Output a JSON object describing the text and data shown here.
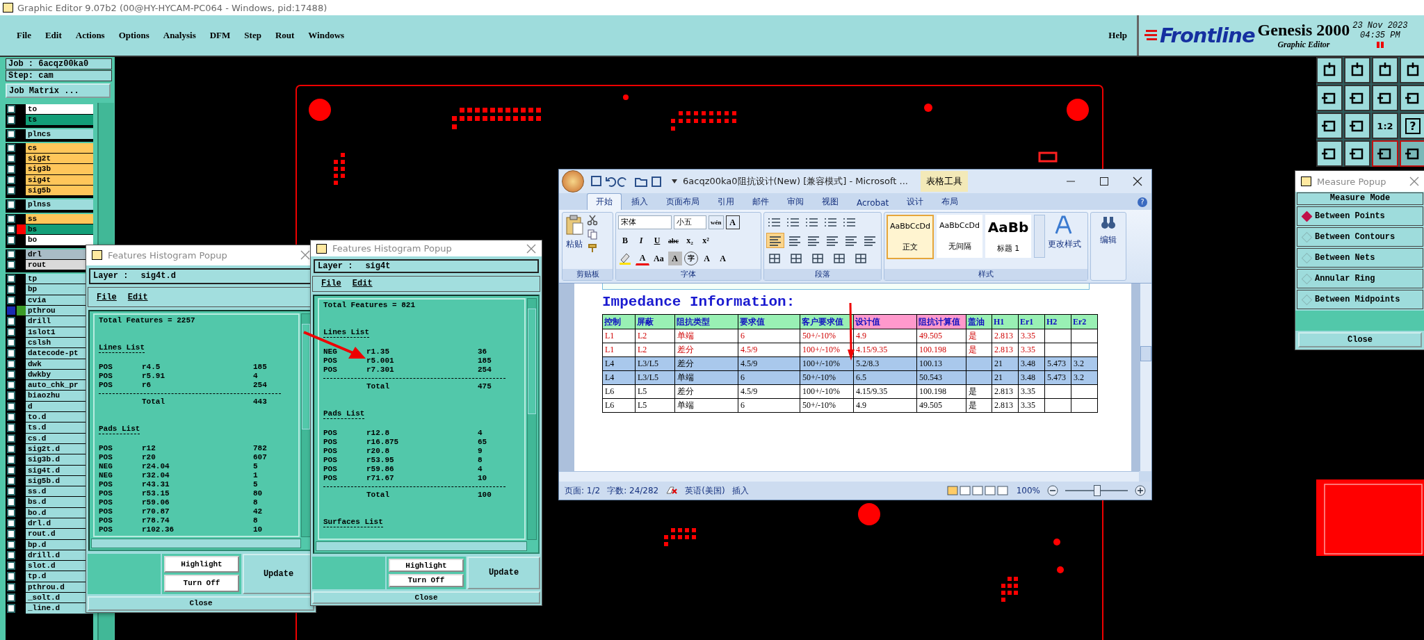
{
  "app_title": "Graphic Editor 9.07b2 (00@HY-HYCAM-PC064 - Windows, pid:17488)",
  "menu": [
    "File",
    "Edit",
    "Actions",
    "Options",
    "Analysis",
    "DFM",
    "Step",
    "Rout",
    "Windows"
  ],
  "help": "Help",
  "brand": {
    "logo": "Frontline",
    "product": "Genesis 2000",
    "subtitle": "Graphic Editor",
    "date": "23 Nov 2023",
    "time": "04:35 PM"
  },
  "job": {
    "job": "Job : 6acqz00ka0",
    "step": "Step: cam",
    "matrix_button": "Job Matrix ..."
  },
  "layer_groups": [
    [
      {
        "name": "to",
        "kind": "silk",
        "selected": false
      },
      {
        "name": "ts",
        "kind": "mask",
        "selected": false
      }
    ],
    [
      {
        "name": "plncs",
        "kind": "misc",
        "selected": false
      }
    ],
    [
      {
        "name": "cs",
        "kind": "signal",
        "selected": false
      },
      {
        "name": "sig2t",
        "kind": "signal",
        "selected": false
      },
      {
        "name": "sig3b",
        "kind": "signal",
        "selected": false
      },
      {
        "name": "sig4t",
        "kind": "signal",
        "selected": false
      },
      {
        "name": "sig5b",
        "kind": "signal",
        "selected": false
      }
    ],
    [
      {
        "name": "plnss",
        "kind": "misc",
        "selected": false
      }
    ],
    [
      {
        "name": "ss",
        "kind": "signal",
        "selected": false
      },
      {
        "name": "bs",
        "kind": "mask",
        "selected": false,
        "color": "#ff0000"
      },
      {
        "name": "bo",
        "kind": "silk",
        "selected": false
      }
    ],
    [
      {
        "name": "drl",
        "kind": "drill",
        "selected": false
      },
      {
        "name": "rout",
        "kind": "rout",
        "selected": false
      }
    ],
    [
      {
        "name": "tp",
        "kind": "misc",
        "selected": false
      },
      {
        "name": "bp",
        "kind": "misc",
        "selected": false
      },
      {
        "name": "cvia",
        "kind": "misc",
        "selected": false
      },
      {
        "name": "pthrou",
        "kind": "misc",
        "selected": true,
        "color": "#3c9a28"
      },
      {
        "name": "drill",
        "kind": "misc",
        "selected": false
      },
      {
        "name": "1slot1",
        "kind": "misc",
        "selected": false
      },
      {
        "name": "cslsh",
        "kind": "misc",
        "selected": false
      },
      {
        "name": "datecode-pt",
        "kind": "misc",
        "selected": false
      },
      {
        "name": "dwk",
        "kind": "misc",
        "selected": false
      },
      {
        "name": "dwkby",
        "kind": "misc",
        "selected": false
      },
      {
        "name": "auto_chk_pr",
        "kind": "misc",
        "selected": false
      },
      {
        "name": "biaozhu",
        "kind": "misc",
        "selected": false
      },
      {
        "name": "d",
        "kind": "misc",
        "selected": false
      },
      {
        "name": "to.d",
        "kind": "misc",
        "selected": false
      },
      {
        "name": "ts.d",
        "kind": "misc",
        "selected": false
      },
      {
        "name": "cs.d",
        "kind": "misc",
        "selected": false
      },
      {
        "name": "sig2t.d",
        "kind": "misc",
        "selected": false
      },
      {
        "name": "sig3b.d",
        "kind": "misc",
        "selected": false
      },
      {
        "name": "sig4t.d",
        "kind": "misc",
        "selected": false
      },
      {
        "name": "sig5b.d",
        "kind": "misc",
        "selected": false
      },
      {
        "name": "ss.d",
        "kind": "misc",
        "selected": false
      },
      {
        "name": "bs.d",
        "kind": "misc",
        "selected": false
      },
      {
        "name": "bo.d",
        "kind": "misc",
        "selected": false
      },
      {
        "name": "drl.d",
        "kind": "misc",
        "selected": false
      },
      {
        "name": "rout.d",
        "kind": "misc",
        "selected": false
      },
      {
        "name": "bp.d",
        "kind": "misc",
        "selected": false
      },
      {
        "name": "drill.d",
        "kind": "misc",
        "selected": false
      },
      {
        "name": "slot.d",
        "kind": "misc",
        "selected": false
      },
      {
        "name": "tp.d",
        "kind": "misc",
        "selected": false
      },
      {
        "name": "pthrou.d",
        "kind": "misc",
        "selected": false
      },
      {
        "name": "_solt.d",
        "kind": "misc",
        "selected": false
      },
      {
        "name": "_line.d",
        "kind": "misc",
        "selected": false
      }
    ]
  ],
  "toolbar": {
    "ratio_label": "1:2",
    "help_glyph": "?"
  },
  "histograms": [
    {
      "title": "Features Histogram Popup",
      "layer_label": "Layer :",
      "layer": "sig4t.d",
      "menu": [
        "File",
        "Edit"
      ],
      "total_features": "Total Features = 2257",
      "sections": [
        {
          "heading": "Lines List",
          "rows": [
            {
              "polarity": "POS",
              "symbol": "r4.5",
              "count": "185"
            },
            {
              "polarity": "POS",
              "symbol": "r5.91",
              "count": "4"
            },
            {
              "polarity": "POS",
              "symbol": "r6",
              "count": "254"
            }
          ],
          "total_label": "Total",
          "total": "443"
        },
        {
          "heading": "Pads List",
          "rows": [
            {
              "polarity": "POS",
              "symbol": "r12",
              "count": "782"
            },
            {
              "polarity": "POS",
              "symbol": "r20",
              "count": "607"
            },
            {
              "polarity": "NEG",
              "symbol": "r24.04",
              "count": "5"
            },
            {
              "polarity": "NEG",
              "symbol": "r32.04",
              "count": "1"
            },
            {
              "polarity": "POS",
              "symbol": "r43.31",
              "count": "5"
            },
            {
              "polarity": "POS",
              "symbol": "r53.15",
              "count": "80"
            },
            {
              "polarity": "POS",
              "symbol": "r59.06",
              "count": "8"
            },
            {
              "polarity": "POS",
              "symbol": "r70.87",
              "count": "42"
            },
            {
              "polarity": "POS",
              "symbol": "r78.74",
              "count": "8"
            },
            {
              "polarity": "POS",
              "symbol": "r102.36",
              "count": "10"
            }
          ]
        }
      ],
      "buttons": {
        "highlight": "Highlight",
        "turn_off": "Turn Off",
        "update": "Update",
        "close": "Close"
      }
    },
    {
      "title": "Features Histogram Popup",
      "layer_label": "Layer :",
      "layer": "sig4t",
      "menu": [
        "File",
        "Edit"
      ],
      "total_features": "Total Features = 821",
      "sections": [
        {
          "heading": "Lines List",
          "rows": [
            {
              "polarity": "NEG",
              "symbol": "r1.35",
              "count": "36"
            },
            {
              "polarity": "POS",
              "symbol": "r5.001",
              "count": "185"
            },
            {
              "polarity": "POS",
              "symbol": "r7.301",
              "count": "254"
            }
          ],
          "total_label": "Total",
          "total": "475"
        },
        {
          "heading": "Pads List",
          "rows": [
            {
              "polarity": "POS",
              "symbol": "r12.8",
              "count": "4"
            },
            {
              "polarity": "POS",
              "symbol": "r16.875",
              "count": "65"
            },
            {
              "polarity": "POS",
              "symbol": "r20.8",
              "count": "9"
            },
            {
              "polarity": "POS",
              "symbol": "r53.95",
              "count": "8"
            },
            {
              "polarity": "POS",
              "symbol": "r59.86",
              "count": "4"
            },
            {
              "polarity": "POS",
              "symbol": "r71.67",
              "count": "10"
            }
          ],
          "total_label": "Total",
          "total": "100"
        },
        {
          "heading": "Surfaces List"
        }
      ],
      "buttons": {
        "highlight": "Highlight",
        "turn_off": "Turn Off",
        "update": "Update",
        "close": "Close"
      }
    }
  ],
  "word": {
    "title": "6acqz00ka0阻抗设计(New) [兼容模式] - Microsoft ...",
    "context_tab": "表格工具",
    "help_glyph": "?",
    "tabs": [
      {
        "label": "开始",
        "selected": true
      },
      {
        "label": "插入",
        "selected": false
      },
      {
        "label": "页面布局",
        "selected": false
      },
      {
        "label": "引用",
        "selected": false
      },
      {
        "label": "邮件",
        "selected": false
      },
      {
        "label": "审阅",
        "selected": false
      },
      {
        "label": "视图",
        "selected": false
      },
      {
        "label": "Acrobat",
        "selected": false
      },
      {
        "label": "设计",
        "selected": false
      },
      {
        "label": "布局",
        "selected": false
      }
    ],
    "ribbon": {
      "paste": "粘贴",
      "clipboard_group": "剪贴板",
      "font_name": "宋体",
      "font_size": "小五",
      "phonetic": "wén",
      "border_char": "A",
      "format_buttons": [
        "B",
        "I",
        "U",
        "abc",
        "x₂",
        "x²"
      ],
      "effect_buttons": [
        "A",
        "Aa",
        "A",
        "字",
        "A",
        "A"
      ],
      "font_group": "字体",
      "paragraph_group": "段落",
      "styles": [
        {
          "preview": "AaBbCcDd",
          "name": "正文",
          "selected": true
        },
        {
          "preview": "AaBbCcDd",
          "name": "无间隔",
          "selected": false
        },
        {
          "preview": "AaBb",
          "name": "标题 1",
          "selected": false
        }
      ],
      "change_styles": "更改样式",
      "styles_group": "样式",
      "editing": "编辑"
    },
    "heading": "Impedance Information:",
    "table": {
      "columns": [
        {
          "text": "控制",
          "color": "#99f0b4"
        },
        {
          "text": "屏蔽",
          "color": "#99f0b4"
        },
        {
          "text": "阻抗类型",
          "color": "#99f0b4"
        },
        {
          "text": "要求值",
          "color": "#99f0b4"
        },
        {
          "text": "客户要求值",
          "color": "#99f0b4"
        },
        {
          "text": "设计值",
          "color": "#ff99cc"
        },
        {
          "text": "阻抗计算值",
          "color": "#ff99cc"
        },
        {
          "text": "盖油",
          "color": "#99f0b4"
        },
        {
          "text": "H1",
          "color": "#99f0b4"
        },
        {
          "text": "Er1",
          "color": "#99f0b4"
        },
        {
          "text": "H2",
          "color": "#99f0b4"
        },
        {
          "text": "Er2",
          "color": "#99f0b4"
        }
      ],
      "rows": [
        {
          "color": "#d00000",
          "selected": false,
          "cells": [
            "L1",
            "L2",
            "单端",
            "6",
            "50+/-10%",
            "4.9",
            "49.505",
            "是",
            "2.813",
            "3.35",
            null,
            null
          ]
        },
        {
          "color": "#d00000",
          "selected": false,
          "cells": [
            "L1",
            "L2",
            "差分",
            "4.5/9",
            "100+/-10%",
            "4.15/9.35",
            "100.198",
            "是",
            "2.813",
            "3.35",
            null,
            null
          ]
        },
        {
          "color": "#000000",
          "selected": true,
          "cells": [
            "L4",
            "L3/L5",
            "差分",
            "4.5/9",
            "100+/-10%",
            "5.2/8.3",
            "100.13",
            null,
            "21",
            "3.48",
            "5.473",
            "3.2"
          ]
        },
        {
          "color": "#000000",
          "selected": true,
          "cells": [
            "L4",
            "L3/L5",
            "单端",
            "6",
            "50+/-10%",
            "6.5",
            "50.543",
            null,
            "21",
            "3.48",
            "5.473",
            "3.2"
          ]
        },
        {
          "color": "#000000",
          "selected": false,
          "cells": [
            "L6",
            "L5",
            "差分",
            "4.5/9",
            "100+/-10%",
            "4.15/9.35",
            "100.198",
            "是",
            "2.813",
            "3.35",
            null,
            null
          ]
        },
        {
          "color": "#000000",
          "selected": false,
          "cells": [
            "L6",
            "L5",
            "单端",
            "6",
            "50+/-10%",
            "4.9",
            "49.505",
            "是",
            "2.813",
            "3.35",
            null,
            null
          ]
        }
      ]
    },
    "status": {
      "page": "页面: 1/2",
      "words": "字数: 24/282",
      "language": "英语(美国)",
      "mode": "插入",
      "zoom": "100%",
      "level": 0.5
    }
  },
  "measure": {
    "title": "Measure Popup",
    "mode_label": "Measure Mode",
    "options": [
      {
        "label": "Between Points",
        "selected": true
      },
      {
        "label": "Between Contours",
        "selected": false
      },
      {
        "label": "Between Nets",
        "selected": false
      },
      {
        "label": "Annular Ring",
        "selected": false
      },
      {
        "label": "Between Midpoints",
        "selected": false
      }
    ],
    "close": "Close"
  }
}
